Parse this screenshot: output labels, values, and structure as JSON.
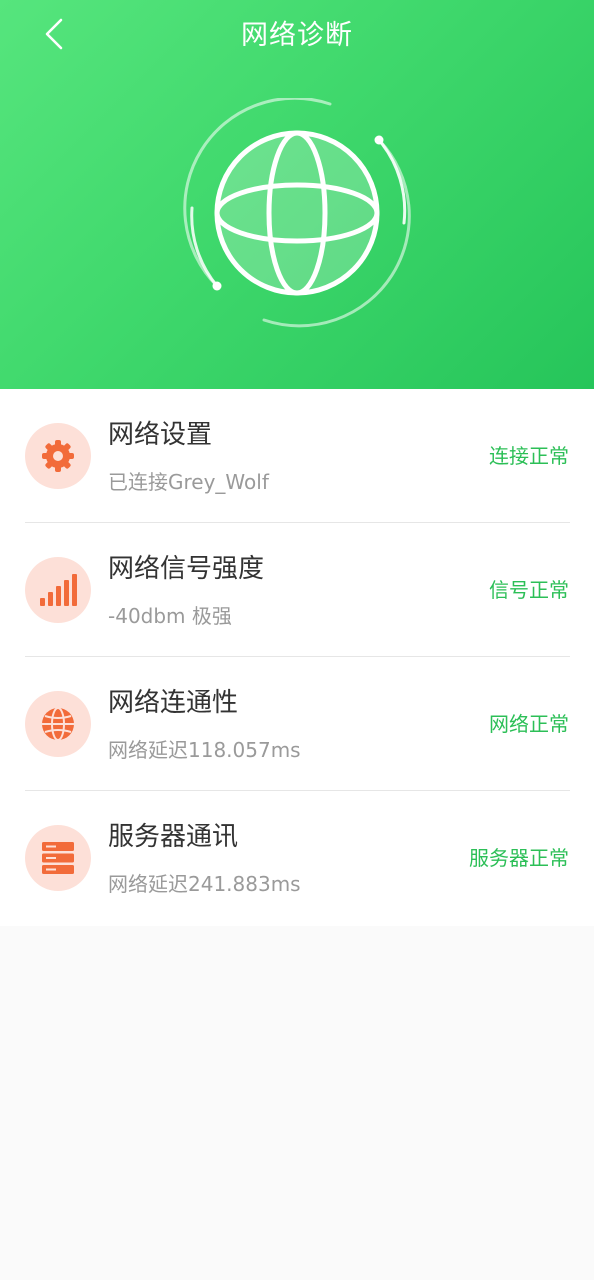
{
  "header": {
    "title": "网络诊断",
    "back_icon": "chevron-left-icon",
    "globe_icon": "globe-icon"
  },
  "colors": {
    "accent": "#2cbf57",
    "header_gradient_start": "#56e57d",
    "header_gradient_end": "#26c55a",
    "icon_bg": "#fde0d8",
    "icon_fg": "#f26b3a"
  },
  "diagnostics": [
    {
      "icon": "gear-icon",
      "title": "网络设置",
      "subtitle": "已连接Grey_Wolf",
      "status": "连接正常"
    },
    {
      "icon": "signal-bars-icon",
      "title": "网络信号强度",
      "subtitle": "-40dbm 极强",
      "status": "信号正常"
    },
    {
      "icon": "globe-icon",
      "title": "网络连通性",
      "subtitle": "网络延迟118.057ms",
      "status": "网络正常"
    },
    {
      "icon": "server-icon",
      "title": "服务器通讯",
      "subtitle": "网络延迟241.883ms",
      "status": "服务器正常"
    }
  ]
}
